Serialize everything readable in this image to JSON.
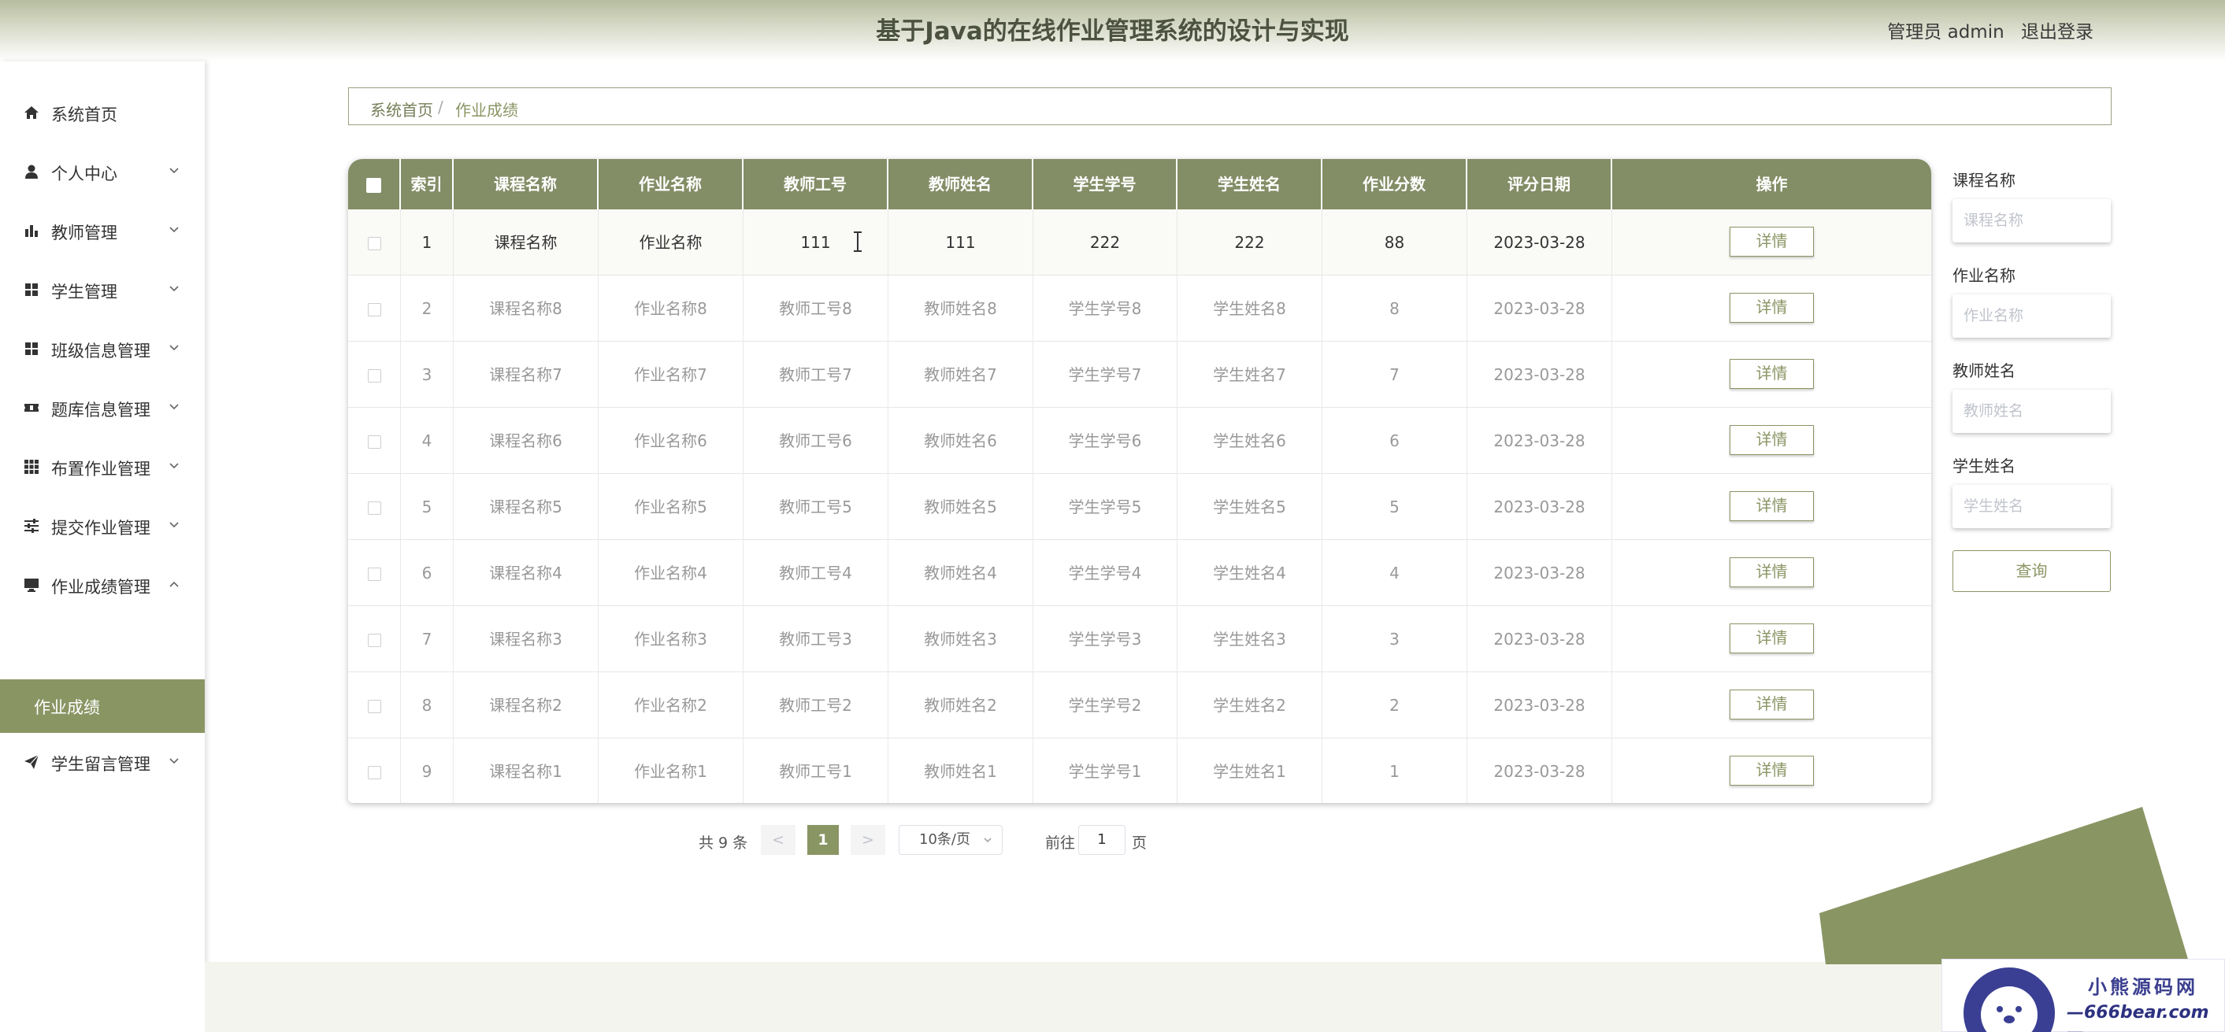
{
  "header": {
    "title": "基于Java的在线作业管理系统的设计与实现",
    "user": "管理员 admin",
    "logout": "退出登录"
  },
  "sidebar": {
    "items": [
      {
        "label": "系统首页",
        "icon": "home-icon",
        "has_children": false
      },
      {
        "label": "个人中心",
        "icon": "user-icon",
        "has_children": true
      },
      {
        "label": "教师管理",
        "icon": "bar-chart-icon",
        "has_children": true
      },
      {
        "label": "学生管理",
        "icon": "grid-icon",
        "has_children": true
      },
      {
        "label": "班级信息管理",
        "icon": "grid-icon",
        "has_children": true
      },
      {
        "label": "题库信息管理",
        "icon": "ticket-icon",
        "has_children": true
      },
      {
        "label": "布置作业管理",
        "icon": "apps-icon",
        "has_children": true
      },
      {
        "label": "提交作业管理",
        "icon": "sliders-icon",
        "has_children": true
      },
      {
        "label": "作业成绩管理",
        "icon": "monitor-icon",
        "has_children": true,
        "expanded": true
      },
      {
        "label": "学生留言管理",
        "icon": "send-icon",
        "has_children": true
      }
    ],
    "active_submenu": "作业成绩"
  },
  "breadcrumb": {
    "home": "系统首页",
    "separator": "/",
    "current": "作业成绩"
  },
  "table": {
    "columns": [
      "索引",
      "课程名称",
      "作业名称",
      "教师工号",
      "教师姓名",
      "学生学号",
      "学生姓名",
      "作业分数",
      "评分日期",
      "操作"
    ],
    "action_label": "详情",
    "rows": [
      {
        "index": "1",
        "course": "课程名称",
        "homework": "作业名称",
        "teacher_no": "111",
        "teacher_name": "111",
        "student_no": "222",
        "student_name": "222",
        "score": "88",
        "date": "2023-03-28"
      },
      {
        "index": "2",
        "course": "课程名称8",
        "homework": "作业名称8",
        "teacher_no": "教师工号8",
        "teacher_name": "教师姓名8",
        "student_no": "学生学号8",
        "student_name": "学生姓名8",
        "score": "8",
        "date": "2023-03-28"
      },
      {
        "index": "3",
        "course": "课程名称7",
        "homework": "作业名称7",
        "teacher_no": "教师工号7",
        "teacher_name": "教师姓名7",
        "student_no": "学生学号7",
        "student_name": "学生姓名7",
        "score": "7",
        "date": "2023-03-28"
      },
      {
        "index": "4",
        "course": "课程名称6",
        "homework": "作业名称6",
        "teacher_no": "教师工号6",
        "teacher_name": "教师姓名6",
        "student_no": "学生学号6",
        "student_name": "学生姓名6",
        "score": "6",
        "date": "2023-03-28"
      },
      {
        "index": "5",
        "course": "课程名称5",
        "homework": "作业名称5",
        "teacher_no": "教师工号5",
        "teacher_name": "教师姓名5",
        "student_no": "学生学号5",
        "student_name": "学生姓名5",
        "score": "5",
        "date": "2023-03-28"
      },
      {
        "index": "6",
        "course": "课程名称4",
        "homework": "作业名称4",
        "teacher_no": "教师工号4",
        "teacher_name": "教师姓名4",
        "student_no": "学生学号4",
        "student_name": "学生姓名4",
        "score": "4",
        "date": "2023-03-28"
      },
      {
        "index": "7",
        "course": "课程名称3",
        "homework": "作业名称3",
        "teacher_no": "教师工号3",
        "teacher_name": "教师姓名3",
        "student_no": "学生学号3",
        "student_name": "学生姓名3",
        "score": "3",
        "date": "2023-03-28"
      },
      {
        "index": "8",
        "course": "课程名称2",
        "homework": "作业名称2",
        "teacher_no": "教师工号2",
        "teacher_name": "教师姓名2",
        "student_no": "学生学号2",
        "student_name": "学生姓名2",
        "score": "2",
        "date": "2023-03-28"
      },
      {
        "index": "9",
        "course": "课程名称1",
        "homework": "作业名称1",
        "teacher_no": "教师工号1",
        "teacher_name": "教师姓名1",
        "student_no": "学生学号1",
        "student_name": "学生姓名1",
        "score": "1",
        "date": "2023-03-28"
      }
    ]
  },
  "pagination": {
    "total": "共 9 条",
    "prev": "<",
    "current_page": "1",
    "next": ">",
    "page_size": "10条/页",
    "jump_label": "前往",
    "jump_value": "1",
    "jump_suffix": "页"
  },
  "search": {
    "fields": [
      {
        "label": "课程名称",
        "placeholder": "课程名称"
      },
      {
        "label": "作业名称",
        "placeholder": "作业名称"
      },
      {
        "label": "教师姓名",
        "placeholder": "教师姓名"
      },
      {
        "label": "学生姓名",
        "placeholder": "学生姓名"
      }
    ],
    "query_button": "查询"
  },
  "watermark": {
    "line1": "小熊源码网",
    "line2": "—666bear.com—"
  },
  "colors": {
    "accent": "#8a9564",
    "header_bg": "#838d66",
    "title": "#4c5240"
  }
}
